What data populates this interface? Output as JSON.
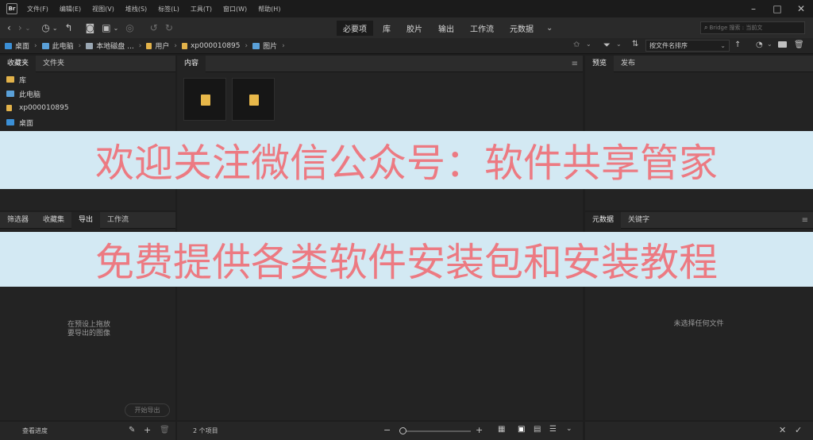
{
  "app": {
    "logo": "Br"
  },
  "menubar": {
    "items": [
      "文件(F)",
      "编辑(E)",
      "视图(V)",
      "堆栈(S)",
      "标签(L)",
      "工具(T)",
      "窗口(W)",
      "帮助(H)"
    ]
  },
  "toolbar": {
    "workspaces": [
      "必要项",
      "库",
      "胶片",
      "输出",
      "工作流",
      "元数据"
    ],
    "active_workspace": "必要项",
    "search_placeholder": "Bridge 搜索 : 当前文"
  },
  "pathbar": {
    "crumbs": [
      {
        "label": "桌面",
        "icon": "desktop-icon",
        "color": "#3b8fd6"
      },
      {
        "label": "此电脑",
        "icon": "computer-icon",
        "color": "#5aa0d8"
      },
      {
        "label": "本地磁盘 ...",
        "icon": "drive-icon",
        "color": "#9aa7b3"
      },
      {
        "label": "用户",
        "icon": "folder-icon",
        "color": "#e2b24a"
      },
      {
        "label": "xp000010895",
        "icon": "folder-icon",
        "color": "#e2b24a"
      },
      {
        "label": "图片",
        "icon": "pictures-icon",
        "color": "#5aa0d8"
      }
    ],
    "sort_label": "按文件名排序"
  },
  "favorites_panel": {
    "tabs": [
      "收藏夹",
      "文件夹"
    ],
    "active_tab": "收藏夹",
    "items": [
      {
        "label": "库",
        "icon": "library-icon",
        "color": "#e2b24a"
      },
      {
        "label": "此电脑",
        "icon": "computer-icon",
        "color": "#5aa0d8"
      },
      {
        "label": "xp000010895",
        "icon": "folder-icon",
        "color": "#e2b24a"
      },
      {
        "label": "桌面",
        "icon": "desktop-icon",
        "color": "#3b8fd6"
      }
    ]
  },
  "content_panel": {
    "tab": "内容",
    "item_count": "2 个项目"
  },
  "preview_panel": {
    "tabs": [
      "预览",
      "发布"
    ],
    "active_tab": "预览"
  },
  "filter_panel": {
    "tabs": [
      "筛选器",
      "收藏集",
      "导出",
      "工作流"
    ],
    "active_tab": "导出",
    "hint_line1": "在预设上拖放",
    "hint_line2": "要导出的图像",
    "export_button": "开始导出",
    "queue_label": "查看进度"
  },
  "metadata_panel": {
    "tabs": [
      "元数据",
      "关键字"
    ],
    "active_tab": "元数据",
    "empty_text": "未选择任何文件"
  },
  "banners": {
    "line1": "欢迎关注微信公众号：软件共享管家",
    "line2": "免费提供各类软件安装包和安装教程"
  },
  "colors": {
    "banner_bg": "#d3e9f3",
    "banner_text": "#ec7a82",
    "folder": "#e8b84a"
  }
}
